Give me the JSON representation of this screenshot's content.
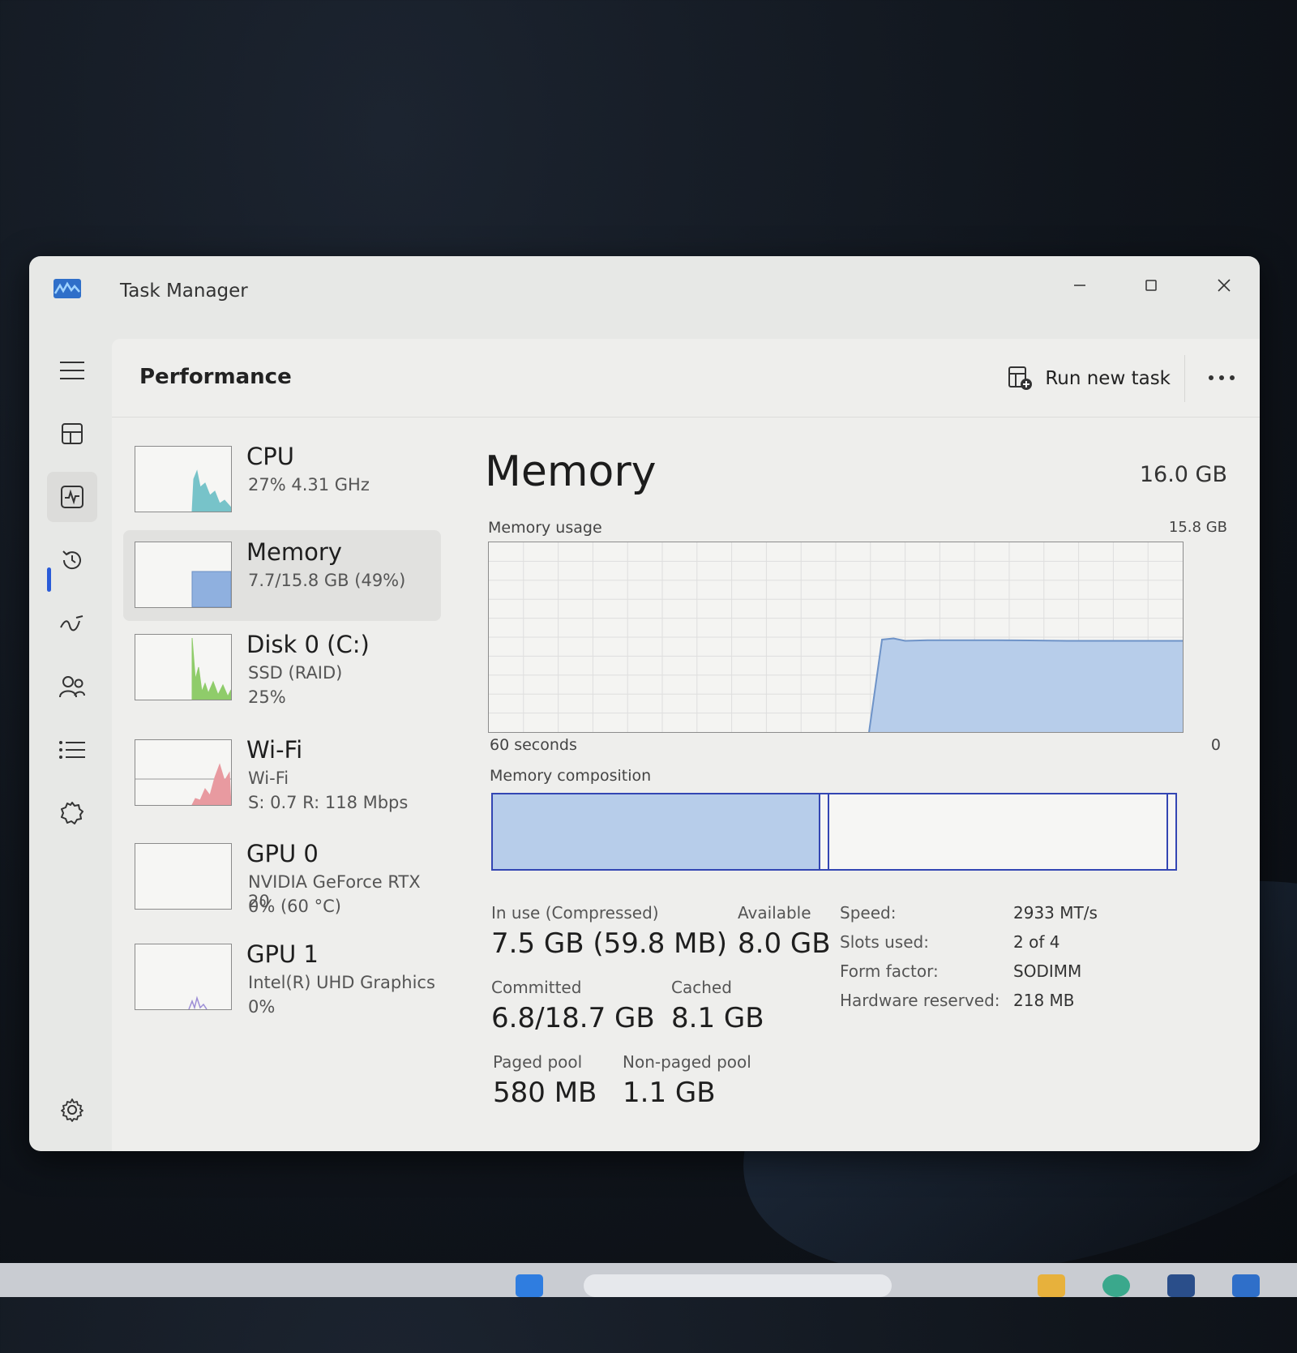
{
  "window": {
    "title": "Task Manager"
  },
  "nav": {
    "items": [
      {
        "name": "hamburger-menu-icon"
      },
      {
        "name": "processes-icon"
      },
      {
        "name": "performance-icon"
      },
      {
        "name": "app-history-icon"
      },
      {
        "name": "startup-apps-icon"
      },
      {
        "name": "users-icon"
      },
      {
        "name": "details-icon"
      },
      {
        "name": "services-icon"
      }
    ],
    "settings_icon": "gear-icon"
  },
  "header": {
    "title": "Performance",
    "run_task_label": "Run new task",
    "more_icon": "more-icon"
  },
  "devices": [
    {
      "name": "CPU",
      "line1": "27%  4.31 GHz",
      "line2": "",
      "color": "#77c3c9"
    },
    {
      "name": "Memory",
      "line1": "7.7/15.8 GB (49%)",
      "line2": "",
      "color": "#8fb0df"
    },
    {
      "name": "Disk 0 (C:)",
      "line1": "SSD (RAID)",
      "line2": "25%",
      "color": "#8fcc6a"
    },
    {
      "name": "Wi-Fi",
      "line1": "Wi-Fi",
      "line2": "S: 0.7  R: 118 Mbps",
      "color": "#e89aa0"
    },
    {
      "name": "GPU 0",
      "line1": "NVIDIA GeForce RTX 20",
      "line2": "0%  (60 °C)",
      "color": "#b2a4de"
    },
    {
      "name": "GPU 1",
      "line1": "Intel(R) UHD Graphics",
      "line2": "0%",
      "color": "#9d8ed6"
    }
  ],
  "memory": {
    "title": "Memory",
    "total": "16.0 GB",
    "usage_label": "Memory usage",
    "usage_max": "15.8 GB",
    "axis_left": "60 seconds",
    "axis_right": "0",
    "composition_label": "Memory composition",
    "composition": {
      "in_use_fraction": 0.477,
      "modified_fraction": 0.013,
      "standby_fraction": 0.497
    },
    "stats": [
      {
        "label": "In use (Compressed)",
        "value": "7.5 GB (59.8 MB)"
      },
      {
        "label": "Available",
        "value": "8.0 GB"
      },
      {
        "label": "Committed",
        "value": "6.8/18.7 GB"
      },
      {
        "label": "Cached",
        "value": "8.1 GB"
      },
      {
        "label": "Paged pool",
        "value": "580 MB"
      },
      {
        "label": "Non-paged pool",
        "value": "1.1 GB"
      }
    ],
    "details": [
      {
        "key": "Speed:",
        "value": "2933 MT/s"
      },
      {
        "key": "Slots used:",
        "value": "2 of 4"
      },
      {
        "key": "Form factor:",
        "value": "SODIMM"
      },
      {
        "key": "Hardware reserved:",
        "value": "218 MB"
      }
    ]
  },
  "chart_data": {
    "type": "area",
    "title": "Memory usage",
    "x": [
      0,
      33,
      34,
      35,
      36,
      38,
      40,
      44,
      50,
      56,
      60
    ],
    "y": [
      null,
      null,
      7.7,
      7.8,
      7.6,
      7.65,
      7.65,
      7.65,
      7.6,
      7.6,
      7.6
    ],
    "xlabel": "",
    "ylabel": "",
    "xlim": [
      0,
      60
    ],
    "ylim": [
      0,
      15.8
    ],
    "grid": true,
    "color": "#b7cdea"
  }
}
